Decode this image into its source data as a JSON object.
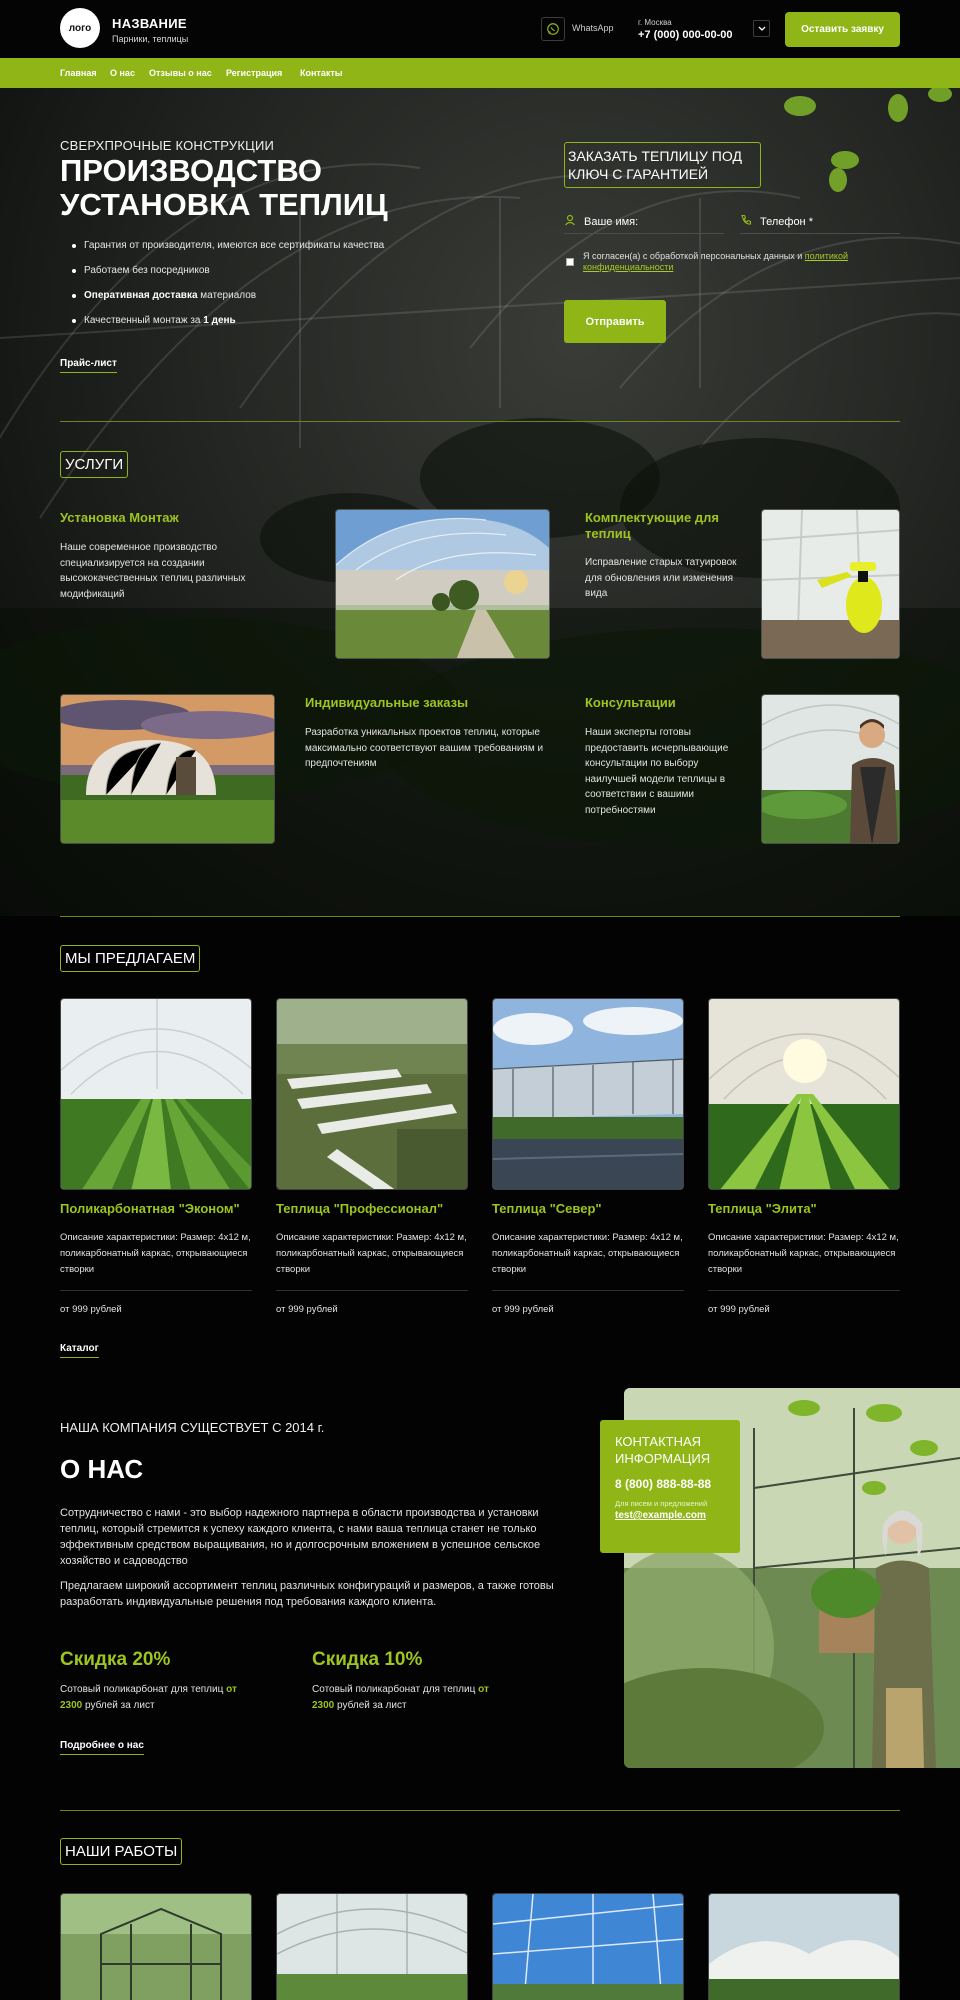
{
  "header": {
    "logo": "лого",
    "brand_name": "НАЗВАНИЕ",
    "brand_sub": "Парники, теплицы",
    "whatsapp": "WhatsApp",
    "city": "г. Москва",
    "phone": "+7 (000) 000-00-00",
    "cta": "Оставить заявку"
  },
  "nav": [
    "Главная",
    "О нас",
    "Отзывы о нас",
    "Регистрация",
    "Контакты"
  ],
  "hero": {
    "eyebrow": "СВЕРХПРОЧНЫЕ КОНСТРУКЦИИ",
    "title": "ПРОИЗВОДСТВО УСТАНОВКА ТЕПЛИЦ",
    "bullets": [
      {
        "pre": "Гарантия от производителя, имеются все сертификаты качества",
        "bold": "",
        "post": ""
      },
      {
        "pre": "Работаем без посредников",
        "bold": "",
        "post": ""
      },
      {
        "pre": "",
        "bold": "Оперативная доставка",
        "post": " материалов"
      },
      {
        "pre": "Качественный монтаж за ",
        "bold": "1 день",
        "post": ""
      }
    ],
    "price_link": "Прайс-лист"
  },
  "form": {
    "title": "ЗАКАЗАТЬ ТЕПЛИЦУ ПОД КЛЮЧ С ГАРАНТИЕЙ",
    "name_placeholder": "Ваше имя:",
    "phone_placeholder": "Телефон *",
    "agree_text": "Я согласен(а) с обработкой персональных данных и ",
    "agree_link": "политикой конфиденциальности",
    "submit": "Отправить"
  },
  "services": {
    "tag": "УСЛУГИ",
    "items": [
      {
        "title": "Установка Монтаж",
        "desc": "Наше современное производство специализируется на создании высококачественных теплиц различных модификаций"
      },
      {
        "title": "Комплектующие для теплиц",
        "desc": "Исправление старых татуировок для обновления или изменения вида"
      },
      {
        "title": "Индивидуальные заказы",
        "desc": "Разработка уникальных проектов теплиц, которые максимально соответствуют вашим требованиям и предпочтениям"
      },
      {
        "title": "Консультации",
        "desc": "Наши эксперты готовы предоставить исчерпывающие консультации по выбору наилучшей модели теплицы в соответствии с вашими потребностями"
      }
    ]
  },
  "offer": {
    "tag": "МЫ ПРЕДЛАГАЕМ",
    "items": [
      {
        "title": "Поликарбонатная \"Эконом\"",
        "desc": "Описание характеристики: Размер: 4x12 м, поликарбонатный каркас, открывающиеся створки",
        "price": "от 999 рублей"
      },
      {
        "title": "Теплица \"Профессионал\"",
        "desc": "Описание характеристики: Размер: 4x12 м, поликарбонатный каркас, открывающиеся створки",
        "price": "от 999 рублей"
      },
      {
        "title": "Теплица \"Север\"",
        "desc": "Описание характеристики: Размер: 4x12 м, поликарбонатный каркас, открывающиеся створки",
        "price": "от 999 рублей"
      },
      {
        "title": "Теплица \"Элита\"",
        "desc": "Описание характеристики: Размер: 4x12 м, поликарбонатный каркас, открывающиеся створки",
        "price": "от 999 рублей"
      }
    ],
    "catalog_link": "Каталог"
  },
  "about": {
    "eyebrow": "НАША КОМПАНИЯ СУЩЕСТВУЕТ С 2014 г.",
    "title": "О НАС",
    "p1": "Сотрудничество с нами - это выбор надежного партнера в области производства и установки теплиц, который стремится к успеху каждого клиента, с нами ваша теплица станет не только эффективным средством выращивания, но и долгосрочным вложением в успешное сельское хозяйство и садоводство",
    "p2": "Предлагаем широкий ассортимент теплиц различных конфигураций и размеров, а также готовы разработать индивидуальные решения под требования каждого клиента.",
    "discounts": [
      {
        "title": "Скидка 20%",
        "pre": "Сотовый поликарбонат для теплиц ",
        "bold1": "от",
        "bold2": "2300",
        "post": " рублей за лист"
      },
      {
        "title": "Скидка 10%",
        "pre": "Сотовый поликарбонат для теплиц ",
        "bold1": "от",
        "bold2": "2300",
        "post": " рублей за лист"
      }
    ],
    "more_link": "Подробнее о нас"
  },
  "contact": {
    "title": "КОНТАКТНАЯ ИНФОРМАЦИЯ",
    "phone": "8 (800) 888-88-88",
    "small": "Для писем и предложений",
    "email": "test@example.com"
  },
  "works": {
    "tag": "НАШИ РАБОТЫ"
  },
  "colors": {
    "accent": "#8fb616",
    "accent_text": "#9dc41f",
    "background": "#020302"
  }
}
